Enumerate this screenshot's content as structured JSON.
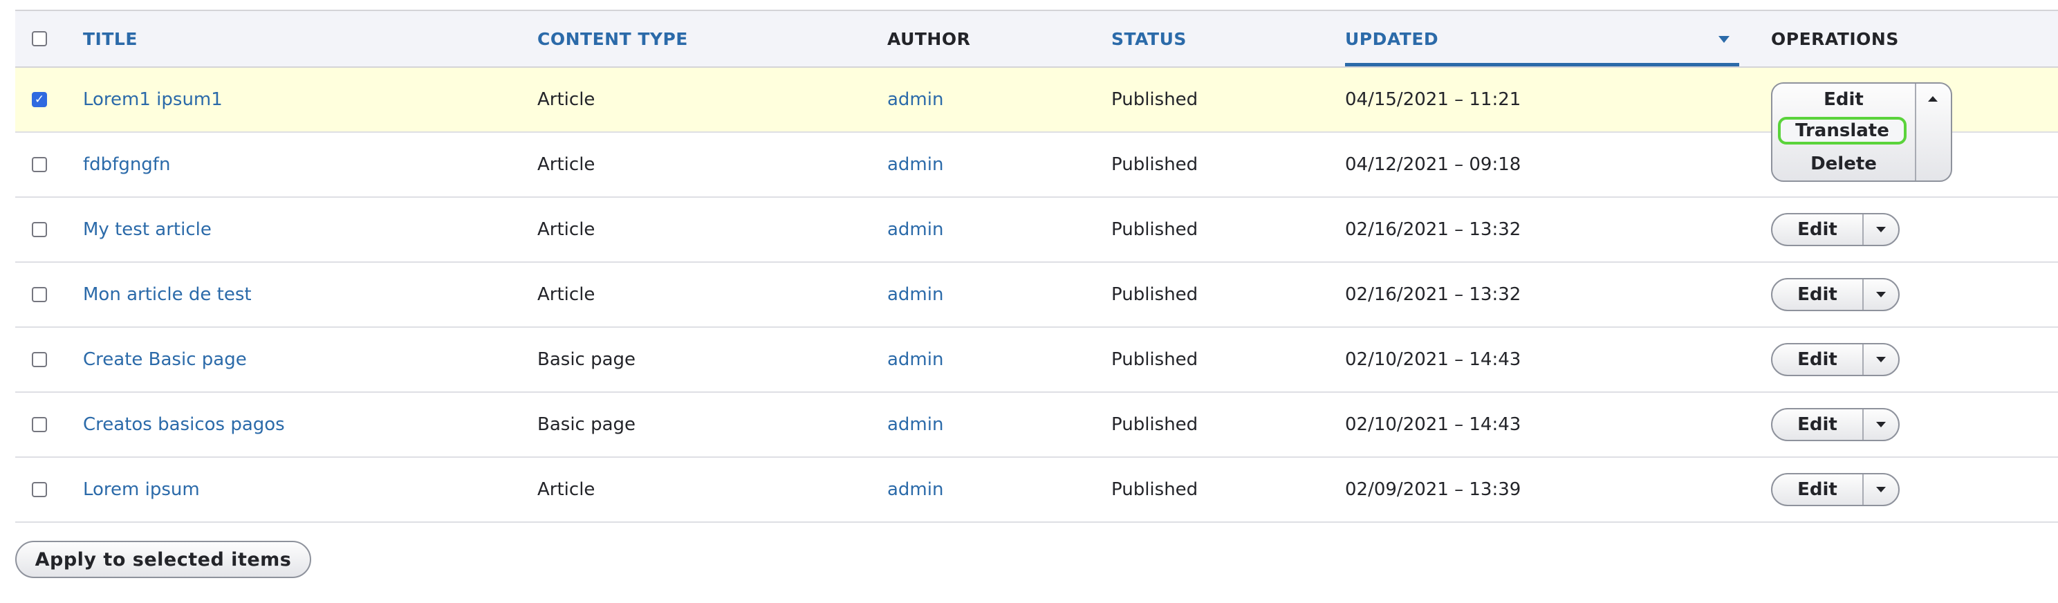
{
  "table": {
    "headers": {
      "title": "TITLE",
      "content_type": "CONTENT TYPE",
      "author": "AUTHOR",
      "status": "STATUS",
      "updated": "UPDATED",
      "operations": "OPERATIONS"
    },
    "rows": [
      {
        "checked": true,
        "title": "Lorem1 ipsum1",
        "type": "Article",
        "author": "admin",
        "status": "Published",
        "updated": "04/15/2021 – 11:21",
        "op": "Edit"
      },
      {
        "checked": false,
        "title": "fdbfgngfn",
        "type": "Article",
        "author": "admin",
        "status": "Published",
        "updated": "04/12/2021 – 09:18",
        "op": "Edit"
      },
      {
        "checked": false,
        "title": "My test article",
        "type": "Article",
        "author": "admin",
        "status": "Published",
        "updated": "02/16/2021 – 13:32",
        "op": "Edit"
      },
      {
        "checked": false,
        "title": "Mon article de test",
        "type": "Article",
        "author": "admin",
        "status": "Published",
        "updated": "02/16/2021 – 13:32",
        "op": "Edit"
      },
      {
        "checked": false,
        "title": "Create Basic page",
        "type": "Basic page",
        "author": "admin",
        "status": "Published",
        "updated": "02/10/2021 – 14:43",
        "op": "Edit"
      },
      {
        "checked": false,
        "title": "Creatos basicos pagos",
        "type": "Basic page",
        "author": "admin",
        "status": "Published",
        "updated": "02/10/2021 – 14:43",
        "op": "Edit"
      },
      {
        "checked": false,
        "title": "Lorem ipsum",
        "type": "Article",
        "author": "admin",
        "status": "Published",
        "updated": "02/09/2021 – 13:39",
        "op": "Edit"
      }
    ]
  },
  "open_dropbutton": {
    "items": [
      "Edit",
      "Translate",
      "Delete"
    ],
    "highlighted": "Translate"
  },
  "actions": {
    "apply_label": "Apply to selected items"
  },
  "colors": {
    "link": "#2b6aa9",
    "selected_row": "#ffffdd",
    "highlight_ring": "#5ad33b",
    "checkbox_checked": "#2f6ae0"
  }
}
